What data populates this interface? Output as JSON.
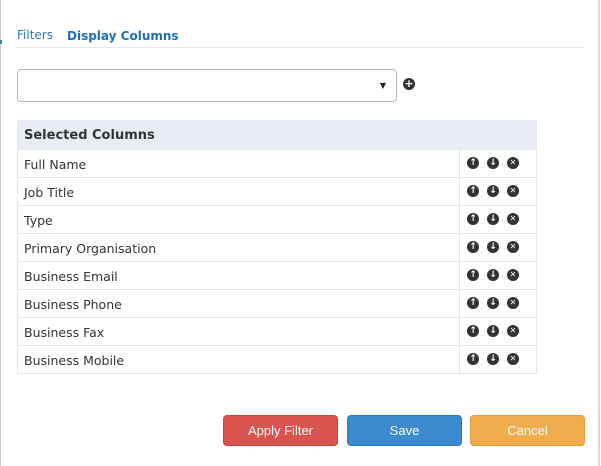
{
  "tabs": [
    {
      "label": "Filters",
      "active": false
    },
    {
      "label": "Display Columns",
      "active": true
    }
  ],
  "column_select": {
    "value": ""
  },
  "table": {
    "header": "Selected Columns",
    "rows": [
      {
        "label": "Full Name"
      },
      {
        "label": "Job Title"
      },
      {
        "label": "Type"
      },
      {
        "label": "Primary Organisation"
      },
      {
        "label": "Business Email"
      },
      {
        "label": "Business Phone"
      },
      {
        "label": "Business Fax"
      },
      {
        "label": "Business Mobile"
      }
    ]
  },
  "icons": {
    "add": "plus-circle-icon",
    "up": "arrow-up-circle-icon",
    "down": "arrow-down-circle-icon",
    "remove": "x-circle-icon"
  },
  "buttons": {
    "apply": "Apply Filter",
    "save": "Save",
    "cancel": "Cancel"
  },
  "colors": {
    "tab_link": "#1f6fb0",
    "table_header_bg": "#e8edf5",
    "apply_button": "#d9534f",
    "save_button": "#3d8ad0",
    "cancel_button": "#f0ad4e"
  }
}
